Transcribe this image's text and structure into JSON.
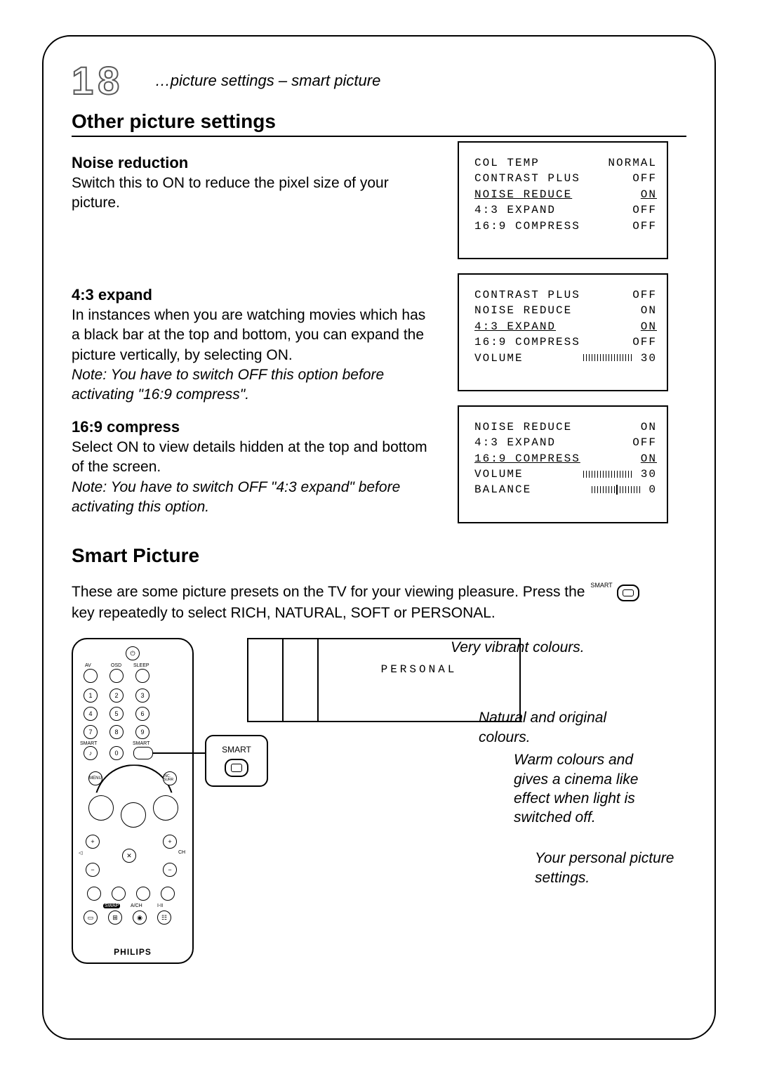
{
  "page_number": "18",
  "breadcrumb": "…picture settings – smart picture",
  "section1_title": "Other picture settings",
  "noise": {
    "heading": "Noise reduction",
    "body": "Switch this to ON to reduce the pixel size of  your picture."
  },
  "expand": {
    "heading": "4:3 expand",
    "body": "In instances when you are watching movies which has a black bar at the top and bottom, you can expand the picture vertically, by selecting ON.",
    "note": "Note: You have to switch OFF this option before activating \"16:9 compress\"."
  },
  "compress": {
    "heading": "16:9 compress",
    "body": "Select ON to view details hidden at the top and bottom of the screen.",
    "note": "Note: You have to switch OFF \"4:3 expand\" before activating this option."
  },
  "osd1": {
    "l1a": "COL TEMP",
    "l1b": "NORMAL",
    "l2a": "CONTRAST PLUS",
    "l2b": "OFF",
    "l3a": "NOISE REDUCE",
    "l3b": "ON",
    "l4a": "4:3 EXPAND",
    "l4b": "OFF",
    "l5a": "16:9 COMPRESS",
    "l5b": "OFF"
  },
  "osd2": {
    "l1a": "CONTRAST PLUS",
    "l1b": "OFF",
    "l2a": "NOISE REDUCE",
    "l2b": "ON",
    "l3a": "4:3 EXPAND",
    "l3b": "ON",
    "l4a": "16:9 COMPRESS",
    "l4b": "OFF",
    "l5a": "VOLUME",
    "l5b": "30"
  },
  "osd3": {
    "l1a": "NOISE REDUCE",
    "l1b": "ON",
    "l2a": "4:3 EXPAND",
    "l2b": "OFF",
    "l3a": "16:9 COMPRESS",
    "l3b": "ON",
    "l4a": "VOLUME",
    "l4b": "30",
    "l5a": "BALANCE",
    "l5b": "0"
  },
  "section2_title": "Smart Picture",
  "smart_intro_a": "These are some picture presets on the TV for your viewing pleasure.  Press the ",
  "smart_intro_b": " key repeatedly to select RICH, NATURAL, SOFT or PERSONAL.",
  "smart_key_label": "SMART",
  "presets": {
    "rich": "RICH",
    "natural": "NATURAL",
    "soft": "SOFT",
    "personal": "PERSONAL"
  },
  "desc": {
    "rich": "Very vibrant colours.",
    "natural": "Natural and original colours.",
    "soft": "Warm colours and gives a cinema like effect when light is switched off.",
    "personal": "Your personal picture settings."
  },
  "remote": {
    "callout_label": "SMART",
    "brand": "PHILIPS",
    "labels": {
      "av": "AV",
      "osd": "OSD",
      "sleep": "SLEEP",
      "smart_sound": "SMART",
      "smart_pic": "SMART",
      "menu": "MENU",
      "inc": "INC.\nSURR",
      "ch": "CH",
      "swap": "SWAP",
      "ach": "A/CH",
      "io": "I-II"
    },
    "digits": [
      "1",
      "2",
      "3",
      "4",
      "5",
      "6",
      "7",
      "8",
      "9",
      "0"
    ]
  }
}
